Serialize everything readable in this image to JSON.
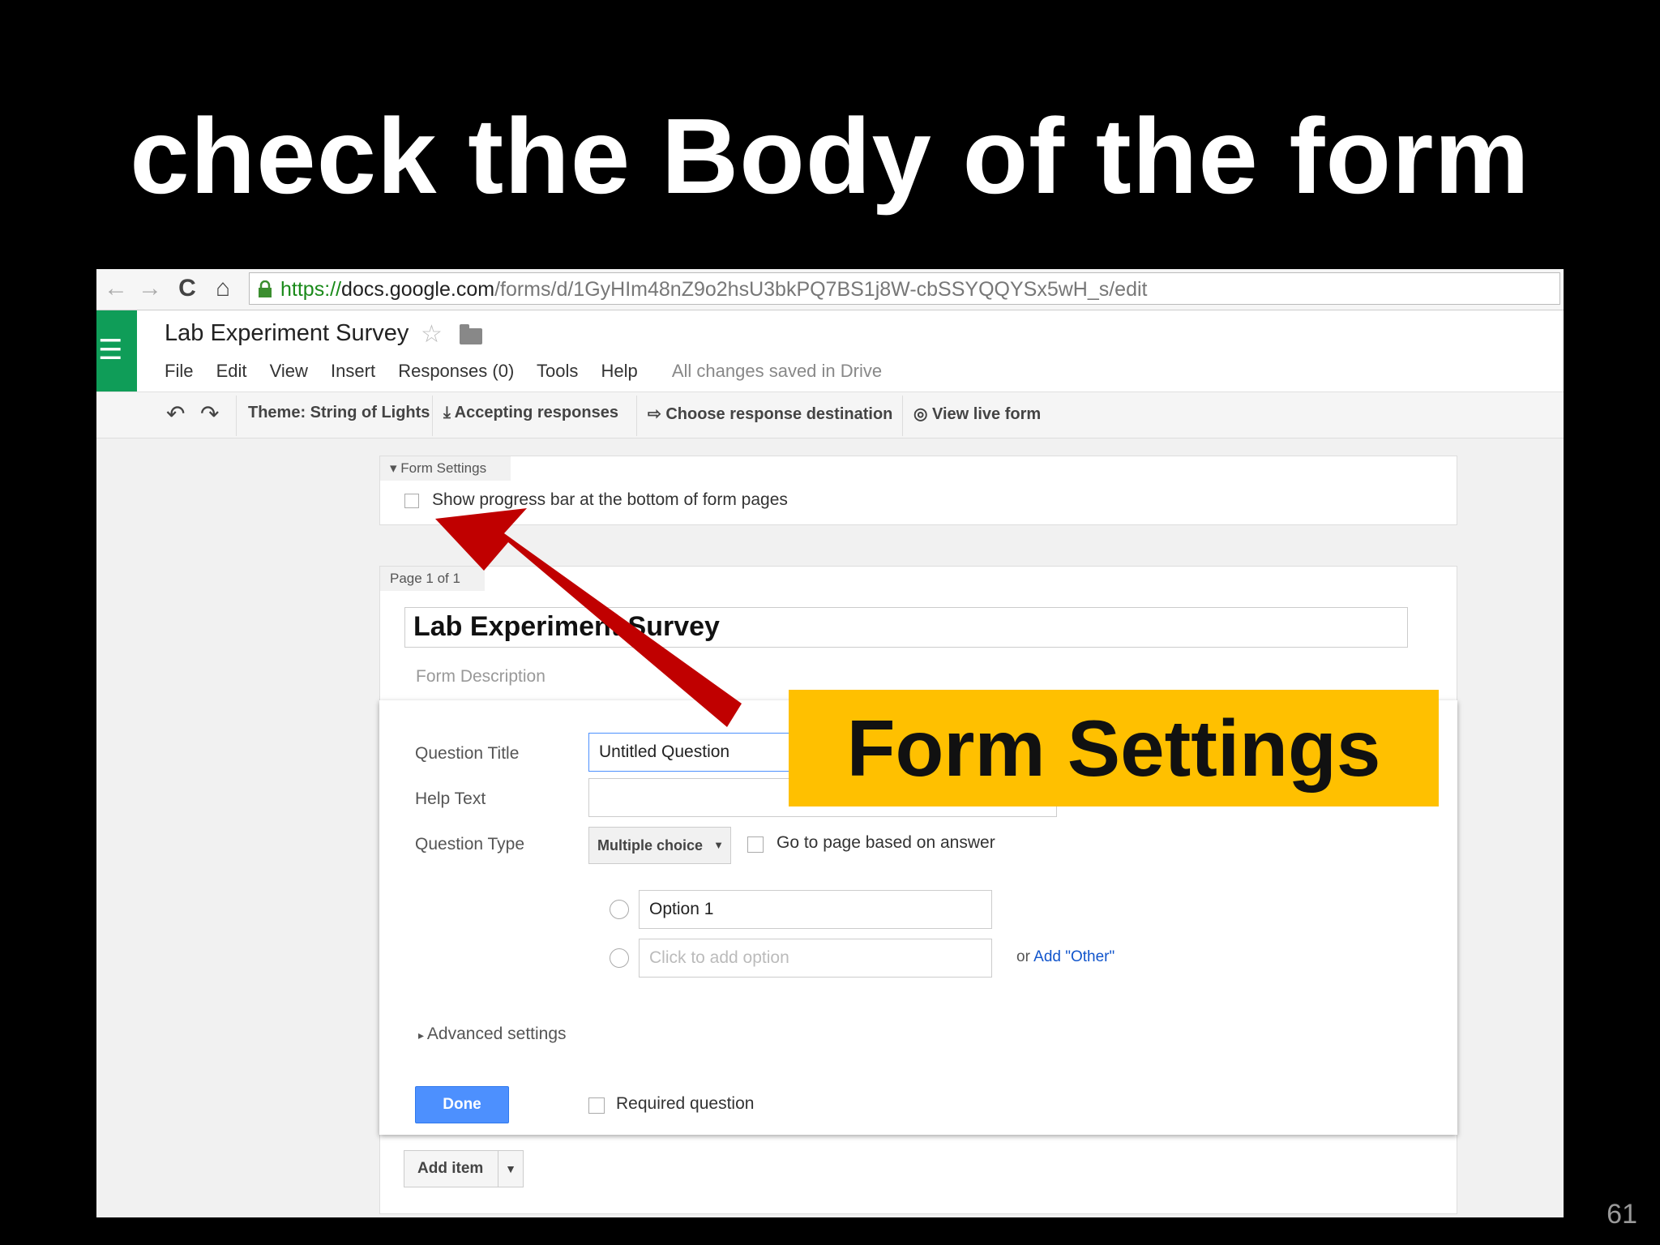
{
  "slide": {
    "title": "check the Body of the form",
    "number": "61"
  },
  "browser": {
    "url": {
      "scheme": "https://",
      "host": "docs.google.com",
      "path": "/forms/d/1GyHIm48nZ9o2hsU3bkPQ7BS1j8W-cbSSYQQYSx5wH_s/edit"
    }
  },
  "app": {
    "doc_title": "Lab Experiment Survey",
    "menu": [
      "File",
      "Edit",
      "View",
      "Insert",
      "Responses (0)",
      "Tools",
      "Help"
    ],
    "save_status": "All changes saved in Drive"
  },
  "toolbar": {
    "theme": "Theme: String of Lights",
    "accepting": "Accepting responses",
    "destination": "Choose response destination",
    "live": "View live form"
  },
  "form_settings": {
    "tab": "Form Settings",
    "progress_bar_label": "Show progress bar at the bottom of form pages"
  },
  "page": {
    "label": "Page 1 of 1",
    "title": "Lab Experiment Survey",
    "description_placeholder": "Form Description"
  },
  "question": {
    "title_label": "Question Title",
    "title_value": "Untitled Question",
    "help_label": "Help Text",
    "type_label": "Question Type",
    "type_value": "Multiple choice",
    "goto_label": "Go to page based on answer",
    "option1": "Option 1",
    "add_option": "Click to add option",
    "or_text": "or",
    "add_other": "Add \"Other\"",
    "advanced": "Advanced settings",
    "done": "Done",
    "required": "Required question"
  },
  "add_item": "Add item",
  "callout": "Form Settings",
  "colors": {
    "callout": "#ffc000",
    "arrow": "#c00000",
    "done_button": "#4d90fe",
    "app_logo": "#0f9d58"
  }
}
